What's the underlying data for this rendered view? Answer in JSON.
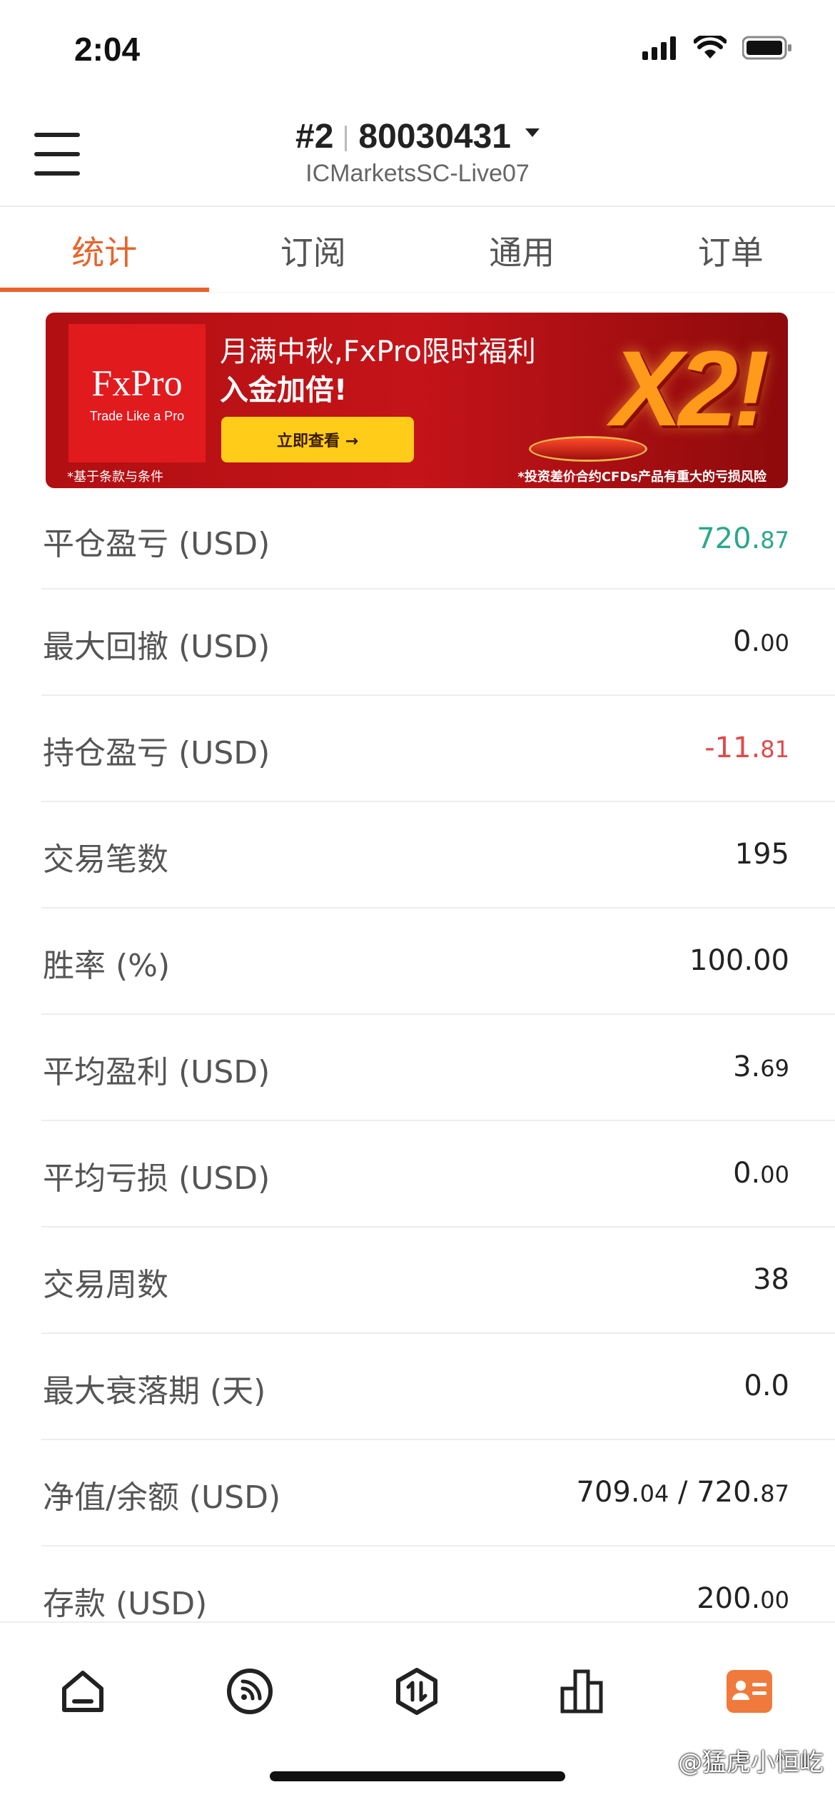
{
  "status_bar": {
    "time": "2:04"
  },
  "header": {
    "account_index": "#2",
    "account_number": "80030431",
    "server": "ICMarketsSC-Live07"
  },
  "tabs": [
    {
      "label": "统计",
      "active": true
    },
    {
      "label": "订阅",
      "active": false
    },
    {
      "label": "通用",
      "active": false
    },
    {
      "label": "订单",
      "active": false
    }
  ],
  "banner": {
    "logo": "FxPro",
    "logo_sub": "Trade Like a Pro",
    "headline": "月满中秋,FxPro限时福利",
    "headline2": "入金加倍!",
    "cta": "立即查看 →",
    "big_text": "X2!",
    "fine_left": "*基于条款与条件",
    "fine_right": "*投资差价合约CFDs产品有重大的亏损风险"
  },
  "stats": [
    {
      "label": "平仓盈亏 (USD)",
      "value_main": "720.",
      "value_small": "87",
      "color": "#2aa88a"
    },
    {
      "label": "最大回撤 (USD)",
      "value_main": "0.",
      "value_small": "00",
      "color": "#222222"
    },
    {
      "label": "持仓盈亏 (USD)",
      "value_main": "-11.",
      "value_small": "81",
      "color": "#e04a4a"
    },
    {
      "label": "交易笔数",
      "value_main": "195",
      "value_small": "",
      "color": "#222222"
    },
    {
      "label": "胜率 (%)",
      "value_main": "100.00",
      "value_small": "",
      "color": "#222222"
    },
    {
      "label": "平均盈利 (USD)",
      "value_main": "3.",
      "value_small": "69",
      "color": "#222222"
    },
    {
      "label": "平均亏损 (USD)",
      "value_main": "0.",
      "value_small": "00",
      "color": "#222222"
    },
    {
      "label": "交易周数",
      "value_main": "38",
      "value_small": "",
      "color": "#222222"
    },
    {
      "label": "最大衰落期 (天)",
      "value_main": "0.0",
      "value_small": "",
      "color": "#222222"
    },
    {
      "label": "净值/余额 (USD)",
      "value_main": "709.",
      "value_small": "04",
      "value_main2": " / 720.",
      "value_small2": "87",
      "color": "#222222"
    },
    {
      "label": "存款 (USD)",
      "value_main": "200.",
      "value_small": "00",
      "color": "#222222"
    }
  ],
  "bottom_nav": [
    {
      "icon": "home-icon",
      "active": false
    },
    {
      "icon": "signal-feed-icon",
      "active": false
    },
    {
      "icon": "trade-icon",
      "active": false
    },
    {
      "icon": "chart-bars-icon",
      "active": false
    },
    {
      "icon": "account-card-icon",
      "active": true
    }
  ],
  "watermark": "@猛虎小恒屹",
  "colors": {
    "accent": "#e8632b",
    "profit": "#2aa88a",
    "loss": "#e04a4a"
  }
}
